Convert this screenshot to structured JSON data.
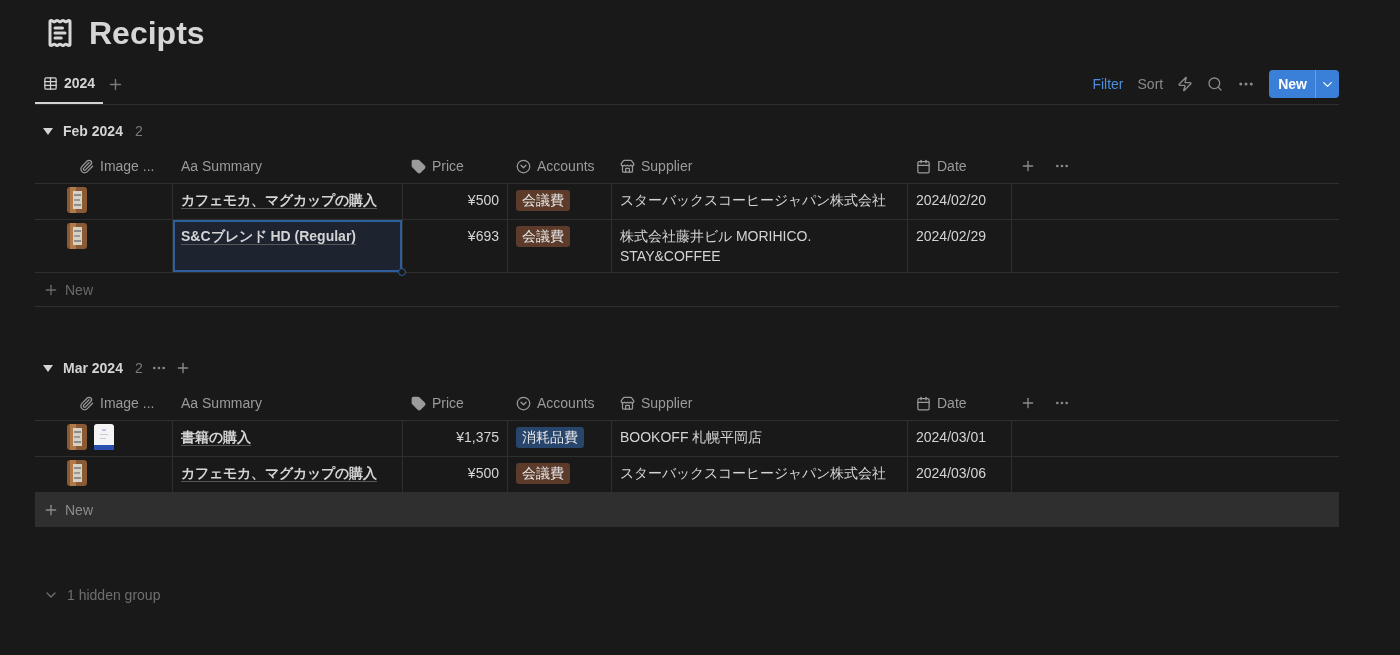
{
  "page": {
    "title": "Recipts"
  },
  "views": [
    {
      "label": "2024",
      "selected": true
    }
  ],
  "toolbar": {
    "filter": {
      "label": "Filter",
      "active": true
    },
    "sort": {
      "label": "Sort",
      "active": false
    },
    "new_button": "New"
  },
  "groups": [
    {
      "name": "Feb 2024",
      "count": "2",
      "expanded": true,
      "hovered": false,
      "new_label": "New",
      "new_hovered": false,
      "columns": [
        {
          "kind": "files",
          "label": "Image ..."
        },
        {
          "kind": "title",
          "label": "Aa Summary"
        },
        {
          "kind": "number",
          "label": "Price"
        },
        {
          "kind": "select",
          "label": "Accounts"
        },
        {
          "kind": "text",
          "label": "Supplier"
        },
        {
          "kind": "date",
          "label": "Date"
        }
      ],
      "rows": [
        {
          "summary": "カフェモカ、マグカップの購入",
          "price": "¥500",
          "account": {
            "label": "会議費",
            "color": "#5c3b2b"
          },
          "supplier": "スターバックスコーヒージャパン株式会社",
          "date": "2024/02/20",
          "selected": false
        },
        {
          "summary": "S&Cブレンド HD (Regular)",
          "price": "¥693",
          "account": {
            "label": "会議費",
            "color": "#5c3b2b"
          },
          "supplier": "株式会社藤井ビル MORIHICO. STAY&COFFEE",
          "date": "2024/02/29",
          "selected": true
        }
      ]
    },
    {
      "name": "Mar 2024",
      "count": "2",
      "expanded": true,
      "hovered": true,
      "new_label": "New",
      "new_hovered": true,
      "columns": [
        {
          "kind": "files",
          "label": "Image ..."
        },
        {
          "kind": "title",
          "label": "Aa Summary"
        },
        {
          "kind": "number",
          "label": "Price"
        },
        {
          "kind": "select",
          "label": "Accounts"
        },
        {
          "kind": "text",
          "label": "Supplier"
        },
        {
          "kind": "date",
          "label": "Date"
        }
      ],
      "rows": [
        {
          "summary": "書籍の購入",
          "price": "¥1,375",
          "account": {
            "label": "消耗品費",
            "color": "#28456c"
          },
          "supplier": "BOOKOFF 札幌平岡店",
          "date": "2024/03/01",
          "selected": false
        },
        {
          "summary": "カフェモカ、マグカップの購入",
          "price": "¥500",
          "account": {
            "label": "会議費",
            "color": "#5c3b2b"
          },
          "supplier": "スターバックスコーヒージャパン株式会社",
          "date": "2024/03/06",
          "selected": false
        }
      ]
    }
  ],
  "hidden_groups": "1 hidden group"
}
